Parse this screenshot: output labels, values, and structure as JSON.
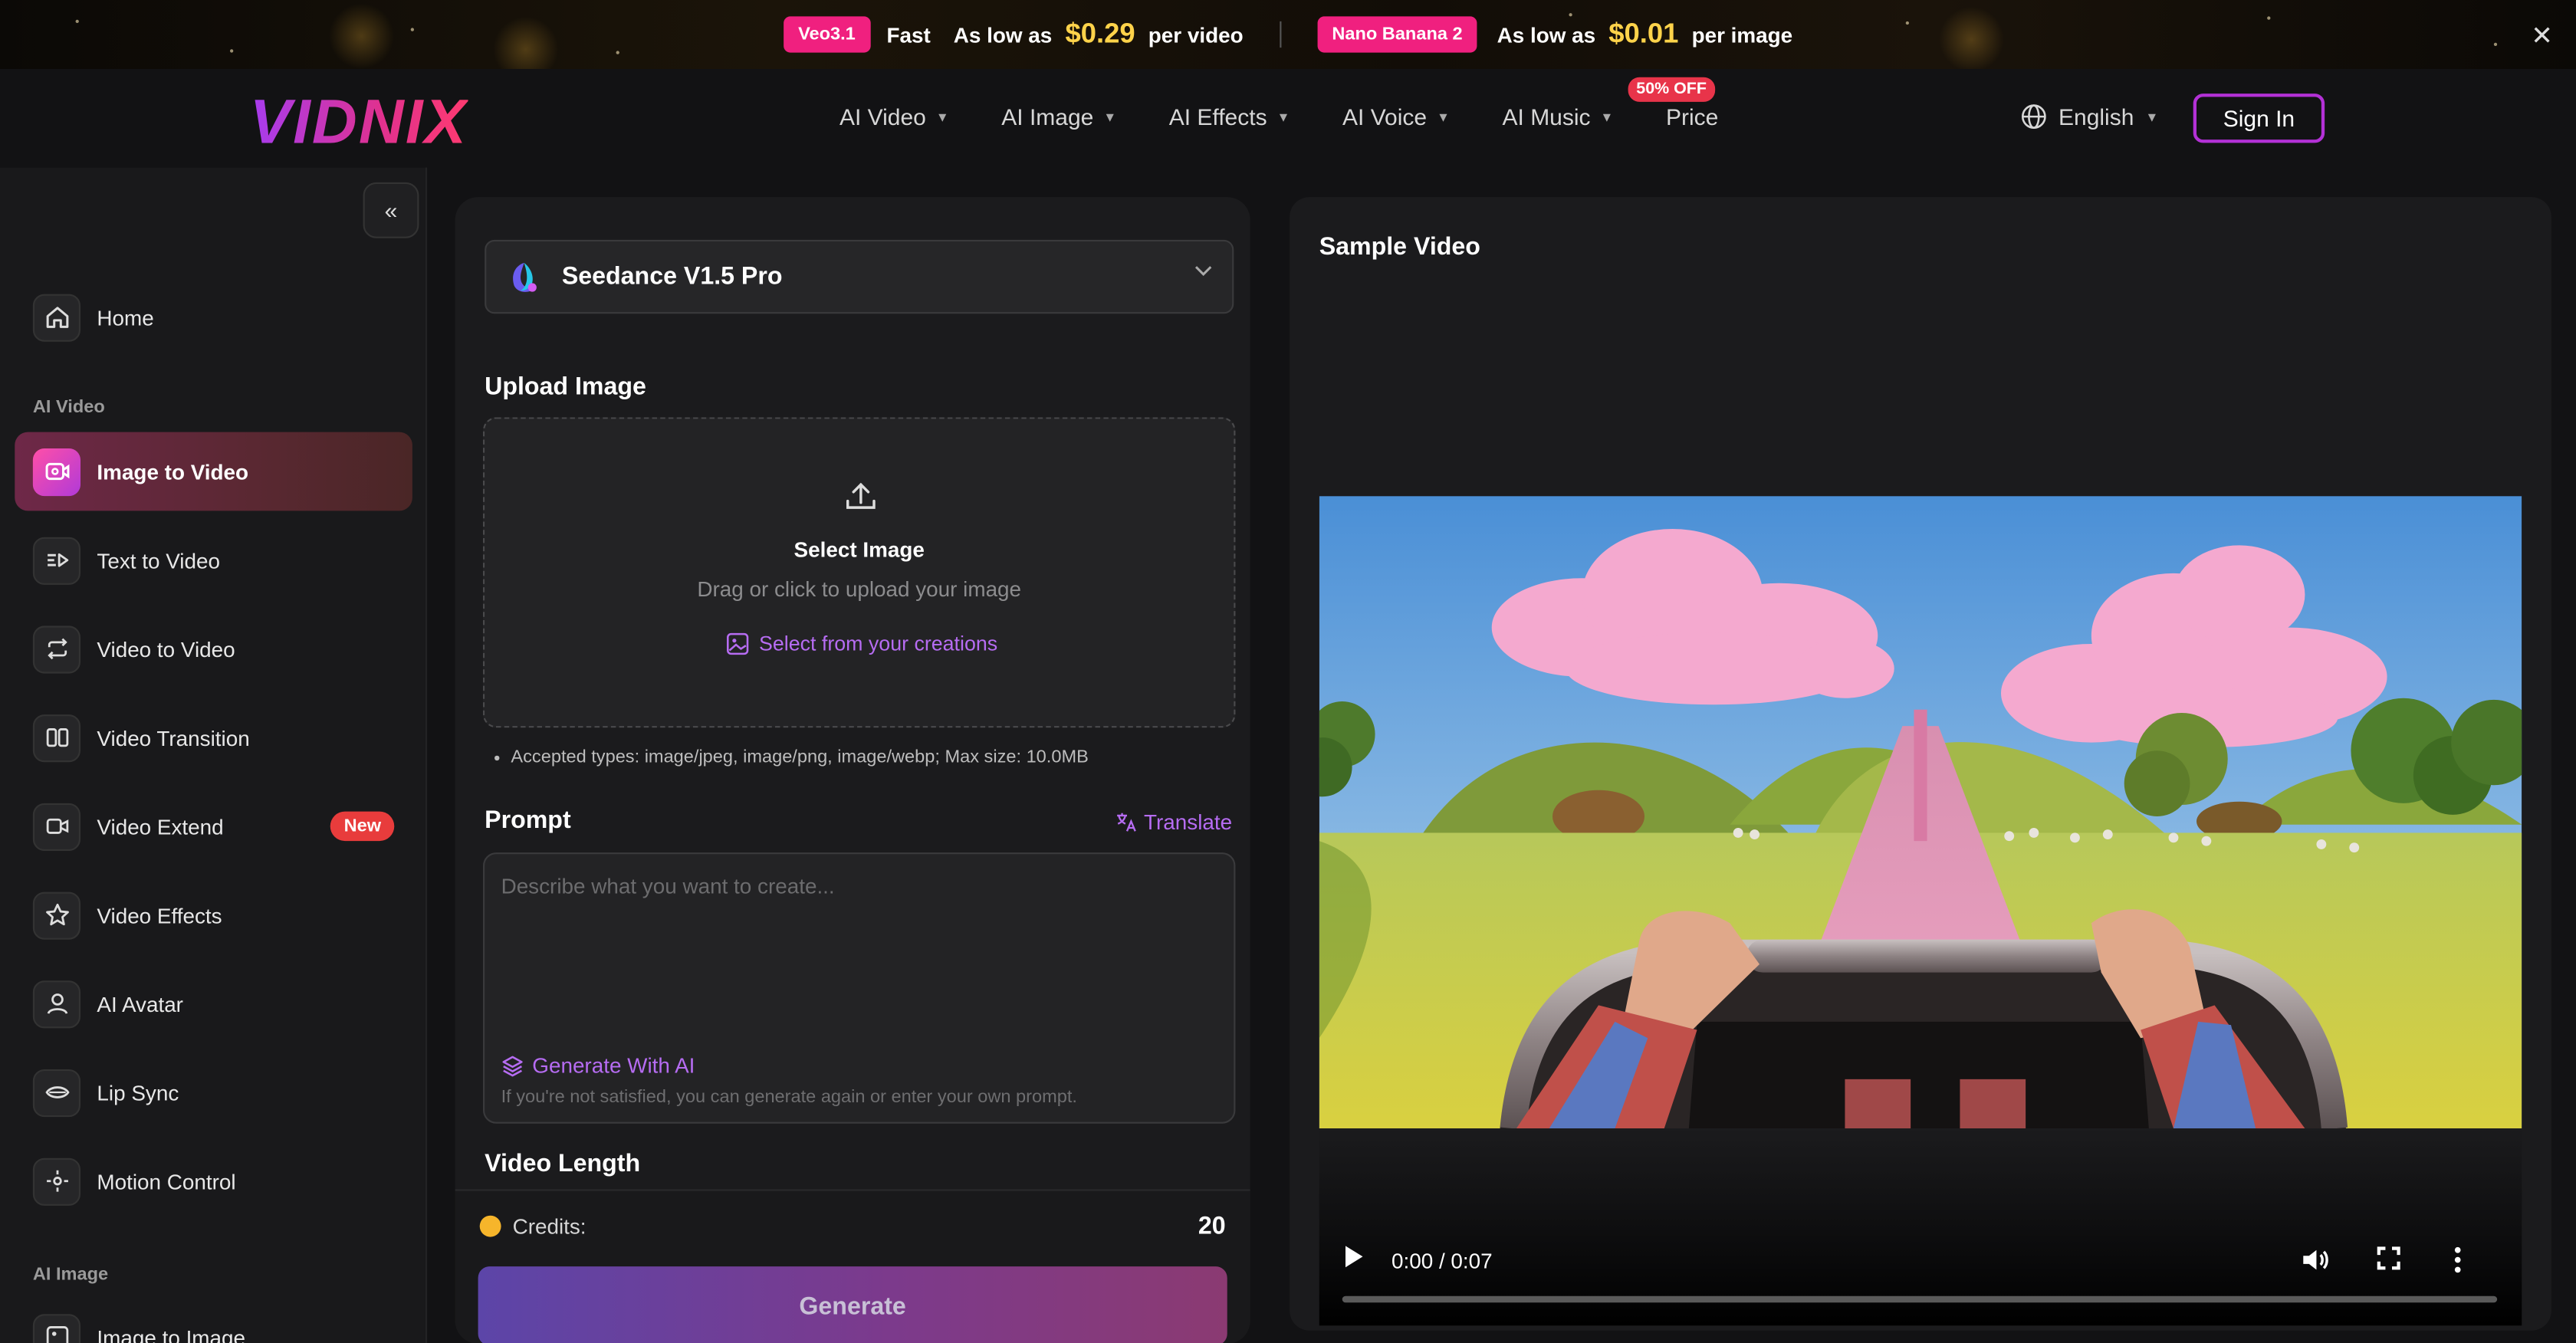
{
  "promo": {
    "left_badge": "Veo3.1",
    "left_fast": "Fast",
    "left_prefix": "As low as",
    "left_price": "$0.29",
    "left_suffix": "per video",
    "right_badge": "Nano Banana 2",
    "right_prefix": "As low as",
    "right_price": "$0.01",
    "right_suffix": "per image",
    "close_icon": "close-icon"
  },
  "header": {
    "logo": "VIDNIX",
    "nav": [
      "AI Video",
      "AI Image",
      "AI Effects",
      "AI Voice",
      "AI Music"
    ],
    "price_label": "Price",
    "price_badge": "50% OFF",
    "language": "English",
    "sign_in": "Sign In"
  },
  "sidebar": {
    "home": "Home",
    "section_video": "AI Video",
    "items": [
      {
        "label": "Image to Video",
        "icon": "image-video-icon",
        "active": true
      },
      {
        "label": "Text to Video",
        "icon": "text-video-icon"
      },
      {
        "label": "Video to Video",
        "icon": "repeat-icon"
      },
      {
        "label": "Video Transition",
        "icon": "transition-icon"
      },
      {
        "label": "Video Extend",
        "icon": "extend-icon",
        "badge": "New"
      },
      {
        "label": "Video Effects",
        "icon": "star-icon"
      },
      {
        "label": "AI Avatar",
        "icon": "user-icon"
      },
      {
        "label": "Lip Sync",
        "icon": "lips-icon"
      },
      {
        "label": "Motion Control",
        "icon": "motion-icon"
      }
    ],
    "section_image": "AI Image",
    "image_item": "Image to Image"
  },
  "form": {
    "model": "Seedance V1.5 Pro",
    "upload_label": "Upload Image",
    "upload_title": "Select Image",
    "upload_sub": "Drag or click to upload your image",
    "upload_link": "Select from your creations",
    "accepted": "Accepted types: image/jpeg, image/png, image/webp; Max size: 10.0MB",
    "prompt_label": "Prompt",
    "translate": "Translate",
    "prompt_placeholder": "Describe what you want to create...",
    "generate_ai": "Generate With AI",
    "generate_hint": "If you're not satisfied, you can generate again or enter your own prompt.",
    "length_label": "Video Length",
    "credits_label": "Credits:",
    "credits_value": "20",
    "generate_button": "Generate"
  },
  "sample": {
    "title": "Sample Video",
    "time": "0:00 / 0:07",
    "progress": 0
  },
  "colors": {
    "accent_purple": "#b66cf2",
    "promo_pink": "#f0207f",
    "price_gold": "#ffd34a"
  }
}
